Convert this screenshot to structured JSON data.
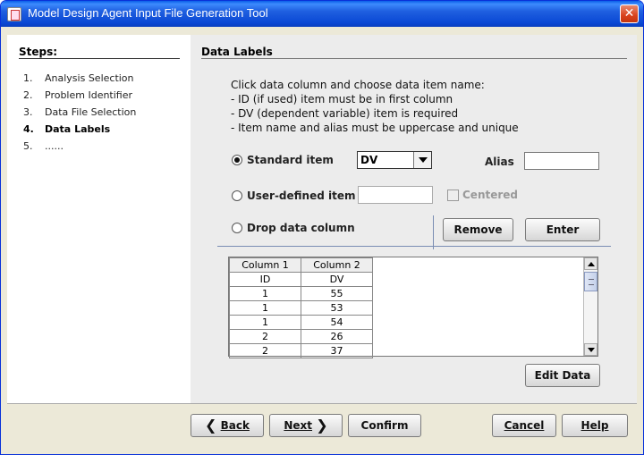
{
  "window": {
    "title": "Model Design Agent Input File Generation Tool",
    "close_label": "✕"
  },
  "steps": {
    "heading": "Steps:",
    "items": [
      {
        "num": "1.",
        "label": "Analysis Selection"
      },
      {
        "num": "2.",
        "label": "Problem Identifier"
      },
      {
        "num": "3.",
        "label": "Data File Selection"
      },
      {
        "num": "4.",
        "label": "Data Labels"
      },
      {
        "num": "5.",
        "label": "......"
      }
    ],
    "active_index": 3
  },
  "main": {
    "title": "Data Labels",
    "instructions": [
      "Click data column and choose data item name:",
      "- ID (if used) item must be in first column",
      "- DV (dependent variable) item is required",
      "- Item name and alias must be uppercase and unique"
    ],
    "options": {
      "standard_item_label": "Standard item",
      "standard_item_selected": true,
      "standard_item_value": "DV",
      "alias_label": "Alias",
      "alias_value": "",
      "user_defined_label": "User-defined item",
      "user_defined_value": "",
      "centered_label": "Centered",
      "drop_column_label": "Drop data column"
    },
    "remove_button": "Remove",
    "enter_button": "Enter",
    "table": {
      "headers": [
        "Column 1",
        "Column 2"
      ],
      "rows": [
        [
          "ID",
          "DV"
        ],
        [
          "1",
          "55"
        ],
        [
          "1",
          "53"
        ],
        [
          "1",
          "54"
        ],
        [
          "2",
          "26"
        ],
        [
          "2",
          "37"
        ]
      ]
    },
    "edit_data_button": "Edit Data"
  },
  "footer": {
    "back_label": "Back",
    "next_label": "Next",
    "confirm_label": "Confirm",
    "cancel_label": "Cancel",
    "help_label": "Help"
  },
  "colors": {
    "titlebar": "#0a48d4",
    "panel_bg": "#ececec"
  }
}
